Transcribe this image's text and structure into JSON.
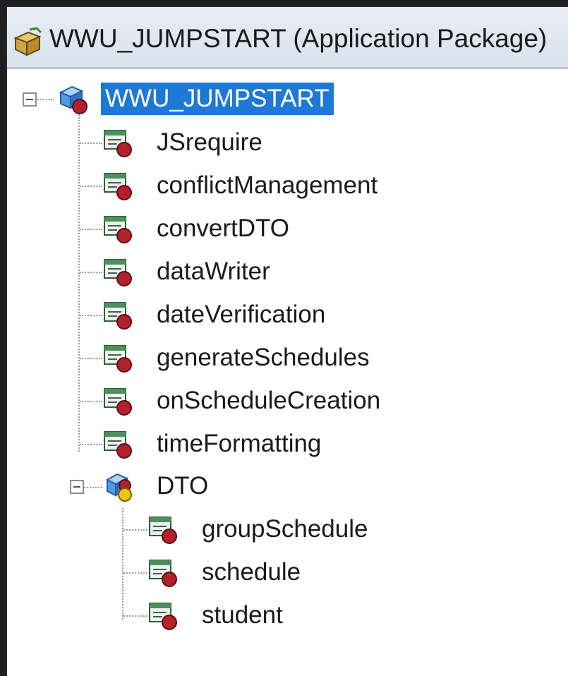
{
  "window": {
    "title": "WWU_JUMPSTART (Application Package)"
  },
  "tree": {
    "root": {
      "label": "WWU_JUMPSTART",
      "icon": "package-cube-icon",
      "expanded": true,
      "selected": true
    },
    "children": [
      {
        "label": "JSrequire",
        "icon": "class-icon"
      },
      {
        "label": "conflictManagement",
        "icon": "class-icon"
      },
      {
        "label": "convertDTO",
        "icon": "class-icon"
      },
      {
        "label": "dataWriter",
        "icon": "class-icon"
      },
      {
        "label": "dateVerification",
        "icon": "class-icon"
      },
      {
        "label": "generateSchedules",
        "icon": "class-icon"
      },
      {
        "label": "onScheduleCreation",
        "icon": "class-icon"
      },
      {
        "label": "timeFormatting",
        "icon": "class-icon"
      }
    ],
    "subpackage": {
      "label": "DTO",
      "icon": "subpackage-icon",
      "expanded": true,
      "children": [
        {
          "label": "groupSchedule",
          "icon": "class-icon"
        },
        {
          "label": "schedule",
          "icon": "class-icon"
        },
        {
          "label": "student",
          "icon": "class-icon"
        }
      ]
    }
  },
  "colors": {
    "selection": "#1e78d6",
    "title_bar": "#dfe6ef",
    "class_badge": "#b3212c"
  }
}
